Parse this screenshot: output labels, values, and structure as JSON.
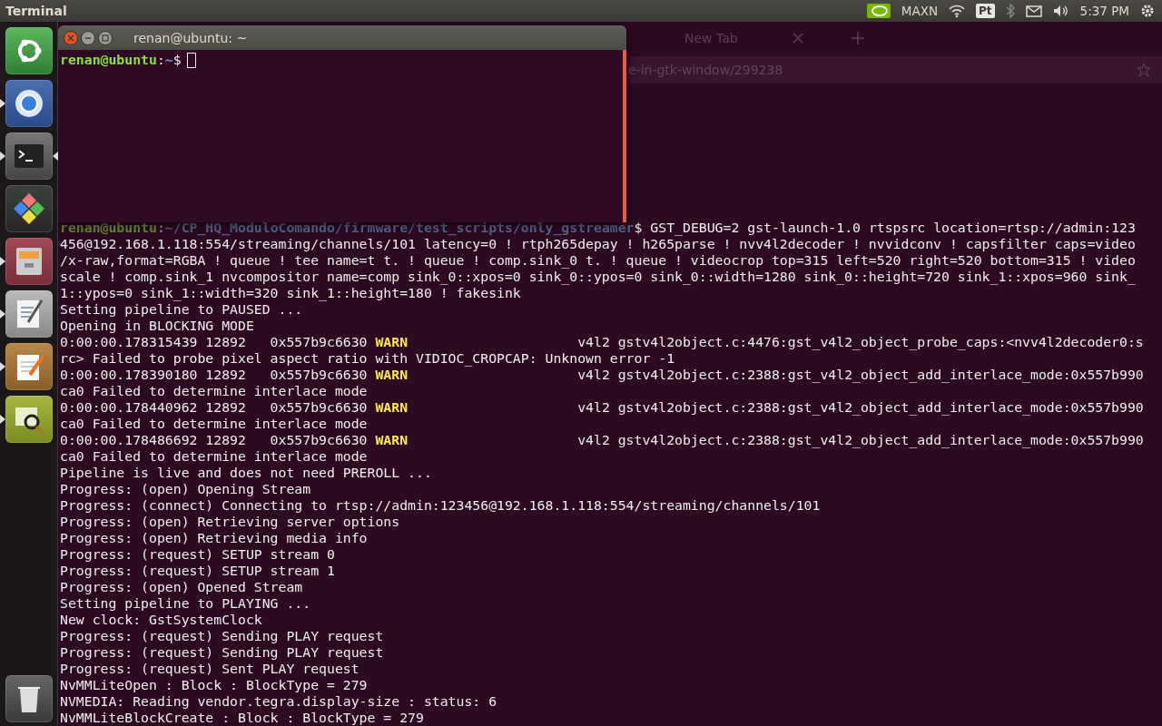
{
  "top_panel": {
    "app_title": "Terminal",
    "indicators": [
      {
        "kind": "nvidia"
      },
      {
        "kind": "text",
        "label": "MAXN"
      },
      {
        "kind": "wifi"
      },
      {
        "kind": "badge",
        "label": "Pt"
      },
      {
        "kind": "bluetooth"
      },
      {
        "kind": "mail"
      },
      {
        "kind": "volume"
      },
      {
        "kind": "text",
        "label": "5:37 PM"
      },
      {
        "kind": "gear"
      }
    ]
  },
  "launcher": {
    "items": [
      {
        "kind": "ubuntu",
        "running": false,
        "focused": false
      },
      {
        "kind": "browser",
        "running": true,
        "focused": false
      },
      {
        "kind": "terminal",
        "running": true,
        "focused": true
      },
      {
        "kind": "git",
        "running": false,
        "focused": false
      },
      {
        "kind": "files",
        "running": true,
        "focused": false
      },
      {
        "kind": "editor",
        "running": true,
        "focused": false
      },
      {
        "kind": "notepad",
        "running": true,
        "focused": false
      },
      {
        "kind": "viewer",
        "running": true,
        "focused": false
      }
    ],
    "trash": {
      "kind": "trash"
    }
  },
  "browser_window": {
    "tab": "New Tab",
    "url": "e-in-gtk-window/299238"
  },
  "small_terminal": {
    "title": "renan@ubuntu: ~",
    "prompt_user": "renan@ubuntu",
    "prompt_sep": ":",
    "prompt_path": "~",
    "prompt_sign": "$"
  },
  "terminal_output": [
    {
      "kind": "prompt",
      "user": "renan@ubuntu",
      "sep": ":",
      "path": "~/CP_HQ_ModuloComando/firmware/test_scripts/only_gstreamer",
      "text": "$ GST_DEBUG=2 gst-launch-1.0 rtspsrc location=rtsp://admin:123"
    },
    {
      "kind": "plain",
      "text": "456@192.168.1.118:554/streaming/channels/101 latency=0 ! rtph265depay ! h265parse ! nvv4l2decoder ! nvvidconv ! capsfilter caps=video"
    },
    {
      "kind": "plain",
      "text": "/x-raw,format=RGBA ! queue ! tee name=t t. ! queue ! comp.sink_0 t. ! queue ! videocrop top=315 left=520 right=520 bottom=315 ! video"
    },
    {
      "kind": "plain",
      "text": "scale ! comp.sink_1 nvcompositor name=comp sink_0::xpos=0 sink_0::ypos=0 sink_0::width=1280 sink_0::height=720 sink_1::xpos=960 sink_"
    },
    {
      "kind": "plain",
      "text": "1::ypos=0 sink_1::width=320 sink_1::height=180 ! fakesink"
    },
    {
      "kind": "plain",
      "text": "Setting pipeline to PAUSED ..."
    },
    {
      "kind": "plain",
      "text": "Opening in BLOCKING MODE"
    },
    {
      "kind": "warn",
      "before": "0:00:00.178315439 12892   0x557b9c6630 ",
      "level": "WARN",
      "after": "                     v4l2 gstv4l2object.c:4476:gst_v4l2_object_probe_caps:<nvv4l2decoder0:s"
    },
    {
      "kind": "plain",
      "text": "rc> Failed to probe pixel aspect ratio with VIDIOC_CROPCAP: Unknown error -1"
    },
    {
      "kind": "warn",
      "before": "0:00:00.178390180 12892   0x557b9c6630 ",
      "level": "WARN",
      "after": "                     v4l2 gstv4l2object.c:2388:gst_v4l2_object_add_interlace_mode:0x557b990"
    },
    {
      "kind": "plain",
      "text": "ca0 Failed to determine interlace mode"
    },
    {
      "kind": "warn",
      "before": "0:00:00.178440962 12892   0x557b9c6630 ",
      "level": "WARN",
      "after": "                     v4l2 gstv4l2object.c:2388:gst_v4l2_object_add_interlace_mode:0x557b990"
    },
    {
      "kind": "plain",
      "text": "ca0 Failed to determine interlace mode"
    },
    {
      "kind": "warn",
      "before": "0:00:00.178486692 12892   0x557b9c6630 ",
      "level": "WARN",
      "after": "                     v4l2 gstv4l2object.c:2388:gst_v4l2_object_add_interlace_mode:0x557b990"
    },
    {
      "kind": "plain",
      "text": "ca0 Failed to determine interlace mode"
    },
    {
      "kind": "plain",
      "text": "Pipeline is live and does not need PREROLL ..."
    },
    {
      "kind": "plain",
      "text": "Progress: (open) Opening Stream"
    },
    {
      "kind": "plain",
      "text": "Progress: (connect) Connecting to rtsp://admin:123456@192.168.1.118:554/streaming/channels/101"
    },
    {
      "kind": "plain",
      "text": "Progress: (open) Retrieving server options"
    },
    {
      "kind": "plain",
      "text": "Progress: (open) Retrieving media info"
    },
    {
      "kind": "plain",
      "text": "Progress: (request) SETUP stream 0"
    },
    {
      "kind": "plain",
      "text": "Progress: (request) SETUP stream 1"
    },
    {
      "kind": "plain",
      "text": "Progress: (open) Opened Stream"
    },
    {
      "kind": "plain",
      "text": "Setting pipeline to PLAYING ..."
    },
    {
      "kind": "plain",
      "text": "New clock: GstSystemClock"
    },
    {
      "kind": "plain",
      "text": "Progress: (request) Sending PLAY request"
    },
    {
      "kind": "plain",
      "text": "Progress: (request) Sending PLAY request"
    },
    {
      "kind": "plain",
      "text": "Progress: (request) Sent PLAY request"
    },
    {
      "kind": "plain",
      "text": "NvMMLiteOpen : Block : BlockType = 279"
    },
    {
      "kind": "plain",
      "text": "NVMEDIA: Reading vendor.tegra.display-size : status: 6"
    },
    {
      "kind": "plain",
      "text": "NvMMLiteBlockCreate : Block : BlockType = 279"
    }
  ]
}
